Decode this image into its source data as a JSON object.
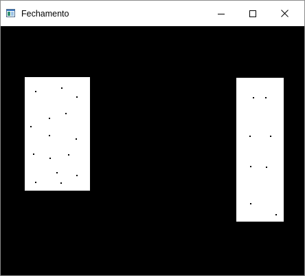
{
  "window": {
    "title": "Fechamento",
    "app_icon": "app-window-icon",
    "controls": [
      {
        "name": "minimize",
        "icon": "minimize-icon"
      },
      {
        "name": "maximize",
        "icon": "maximize-icon"
      },
      {
        "name": "close",
        "icon": "close-icon"
      }
    ]
  },
  "colors": {
    "canvas_background": "#000000",
    "panel_fill": "#ffffff",
    "dot_color": "#000000",
    "titlebar_background": "#ffffff"
  }
}
